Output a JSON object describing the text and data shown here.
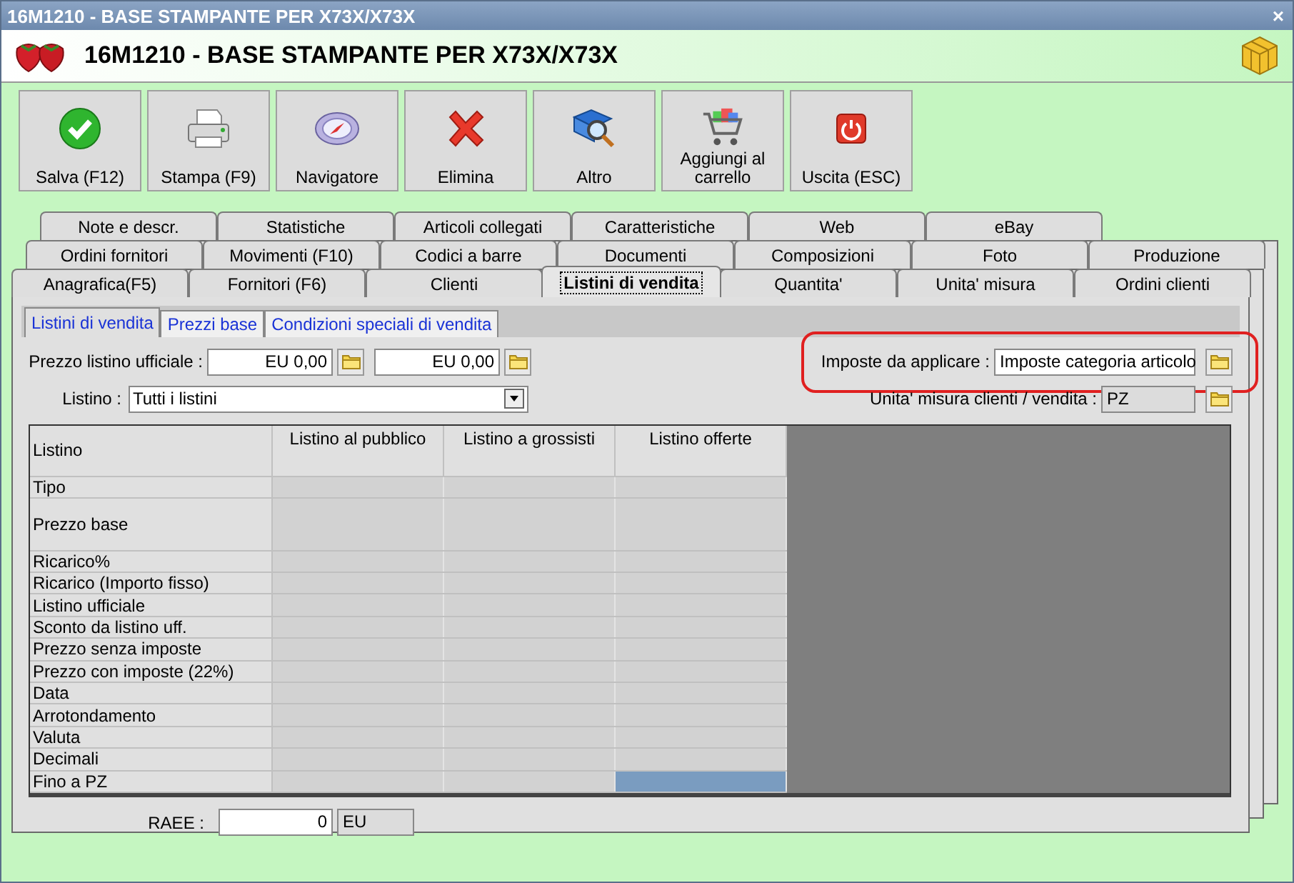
{
  "window": {
    "title": "16M1210 - BASE STAMPANTE PER X73X/X73X",
    "close": "×"
  },
  "header": {
    "title": "16M1210 - BASE STAMPANTE PER X73X/X73X"
  },
  "toolbar": [
    {
      "label": "Salva (F12)",
      "kind": "check"
    },
    {
      "label": "Stampa (F9)",
      "kind": "printer"
    },
    {
      "label": "Navigatore",
      "kind": "compass"
    },
    {
      "label": "Elimina",
      "kind": "cross"
    },
    {
      "label": "Altro",
      "kind": "book"
    },
    {
      "label": "Aggiungi al carrello",
      "kind": "cart"
    },
    {
      "label": "Uscita (ESC)",
      "kind": "power"
    }
  ],
  "tab_rows": [
    [
      {
        "label": "Note e descr.",
        "selected": false
      },
      {
        "label": "Statistiche",
        "selected": false
      },
      {
        "label": "Articoli collegati",
        "selected": false
      },
      {
        "label": "Caratteristiche",
        "selected": false
      },
      {
        "label": "Web",
        "selected": false
      },
      {
        "label": "eBay",
        "selected": false
      }
    ],
    [
      {
        "label": "Ordini fornitori",
        "selected": false
      },
      {
        "label": "Movimenti (F10)",
        "selected": false
      },
      {
        "label": "Codici a barre",
        "selected": false
      },
      {
        "label": "Documenti",
        "selected": false
      },
      {
        "label": "Composizioni",
        "selected": false
      },
      {
        "label": "Foto",
        "selected": false
      },
      {
        "label": "Produzione",
        "selected": false
      }
    ],
    [
      {
        "label": "Anagrafica(F5)",
        "selected": false
      },
      {
        "label": "Fornitori (F6)",
        "selected": false
      },
      {
        "label": "Clienti",
        "selected": false
      },
      {
        "label": "Listini di vendita",
        "selected": true
      },
      {
        "label": "Quantita'",
        "selected": false
      },
      {
        "label": "Unita' misura",
        "selected": false
      },
      {
        "label": "Ordini clienti",
        "selected": false
      }
    ]
  ],
  "subtabs": [
    {
      "label": "Listini di vendita",
      "selected": true
    },
    {
      "label": "Prezzi base",
      "selected": false
    },
    {
      "label": "Condizioni speciali di vendita",
      "selected": false
    }
  ],
  "prezzo_listino_ufficiale": {
    "label": "Prezzo listino ufficiale :",
    "values": [
      "EU 0,00",
      "EU 0,00"
    ]
  },
  "listino": {
    "label": "Listino :",
    "value": "Tutti i listini"
  },
  "imposte": {
    "label": "Imposte da applicare :",
    "value": "Imposte categoria articolo",
    "highlighted": true
  },
  "unita_misura": {
    "label": "Unita' misura clienti / vendita :",
    "value": "PZ"
  },
  "table": {
    "corner": "Listino",
    "columns": [
      "Listino al pubblico",
      "Listino a grossisti",
      "Listino offerte"
    ],
    "rows": [
      {
        "label": "Tipo",
        "kind": "normal",
        "cells": [
          {
            "selected": false
          },
          {
            "selected": false
          },
          {
            "selected": false
          }
        ]
      },
      {
        "label": "Prezzo base",
        "kind": "tall",
        "cells": [
          {
            "selected": false
          },
          {
            "selected": false
          },
          {
            "selected": false
          }
        ]
      },
      {
        "label": "Ricarico%",
        "kind": "normal",
        "cells": [
          {
            "selected": false
          },
          {
            "selected": false
          },
          {
            "selected": false
          }
        ]
      },
      {
        "label": "Ricarico (Importo fisso)",
        "kind": "normal",
        "cells": [
          {
            "selected": false
          },
          {
            "selected": false
          },
          {
            "selected": false
          }
        ]
      },
      {
        "label": "Listino ufficiale",
        "kind": "normal",
        "cells": [
          {
            "selected": false
          },
          {
            "selected": false
          },
          {
            "selected": false
          }
        ]
      },
      {
        "label": "Sconto da listino uff.",
        "kind": "normal",
        "cells": [
          {
            "selected": false
          },
          {
            "selected": false
          },
          {
            "selected": false
          }
        ]
      },
      {
        "label": "Prezzo senza imposte",
        "kind": "normal",
        "cells": [
          {
            "selected": false
          },
          {
            "selected": false
          },
          {
            "selected": false
          }
        ]
      },
      {
        "label": "Prezzo con imposte (22%)",
        "kind": "normal",
        "cells": [
          {
            "selected": false
          },
          {
            "selected": false
          },
          {
            "selected": false
          }
        ]
      },
      {
        "label": "Data",
        "kind": "normal",
        "cells": [
          {
            "selected": false
          },
          {
            "selected": false
          },
          {
            "selected": false
          }
        ]
      },
      {
        "label": "Arrotondamento",
        "kind": "normal",
        "cells": [
          {
            "selected": false
          },
          {
            "selected": false
          },
          {
            "selected": false
          }
        ]
      },
      {
        "label": "Valuta",
        "kind": "normal",
        "cells": [
          {
            "selected": false
          },
          {
            "selected": false
          },
          {
            "selected": false
          }
        ]
      },
      {
        "label": "Decimali",
        "kind": "normal",
        "cells": [
          {
            "selected": false
          },
          {
            "selected": false
          },
          {
            "selected": false
          }
        ]
      },
      {
        "label": "Fino a PZ",
        "kind": "normal",
        "cells": [
          {
            "selected": false
          },
          {
            "selected": false
          },
          {
            "selected": true
          }
        ]
      }
    ]
  },
  "raee": {
    "label": "RAEE :",
    "value": "0",
    "unit": "EU"
  }
}
